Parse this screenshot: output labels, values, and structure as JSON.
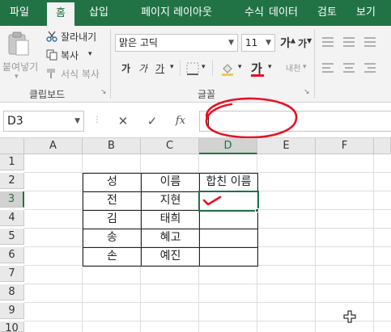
{
  "ribbon_tabs": [
    "파일",
    "홈",
    "삽입",
    "페이지 레이아웃",
    "수식",
    "데이터",
    "검토",
    "보기"
  ],
  "clipboard": {
    "paste_label": "붙여넣기",
    "cut_label": "잘라내기",
    "copy_label": "복사",
    "format_painter_label": "서식 복사",
    "group_label": "클립보드"
  },
  "font": {
    "family": "맑은 고딕",
    "size": "11",
    "bold_glyph": "가",
    "italic_glyph": "가",
    "underline_glyph": "가",
    "grow_glyph": "가",
    "shrink_glyph": "가",
    "font_color_glyph": "가",
    "phonetic_label": "내천",
    "group_label": "글꼴",
    "font_color_hex": "#e81123"
  },
  "formula_bar": {
    "name_box": "D3",
    "fx_label": "fx",
    "cancel_glyph": "✕",
    "enter_glyph": "✓",
    "value": ""
  },
  "sheet": {
    "columns": [
      "A",
      "B",
      "C",
      "D",
      "E",
      "F"
    ],
    "rows": [
      "1",
      "2",
      "3",
      "4",
      "5",
      "6",
      "7",
      "8",
      "9",
      "10"
    ],
    "table": {
      "headers": [
        "성",
        "이름",
        "합친 이름"
      ],
      "rows": [
        [
          "전",
          "지현",
          ""
        ],
        [
          "김",
          "태희",
          ""
        ],
        [
          "송",
          "혜고",
          ""
        ],
        [
          "손",
          "예진",
          ""
        ]
      ]
    },
    "selected_cell": "D3"
  },
  "colors": {
    "accent": "#217346",
    "annotation": "#e81123"
  }
}
